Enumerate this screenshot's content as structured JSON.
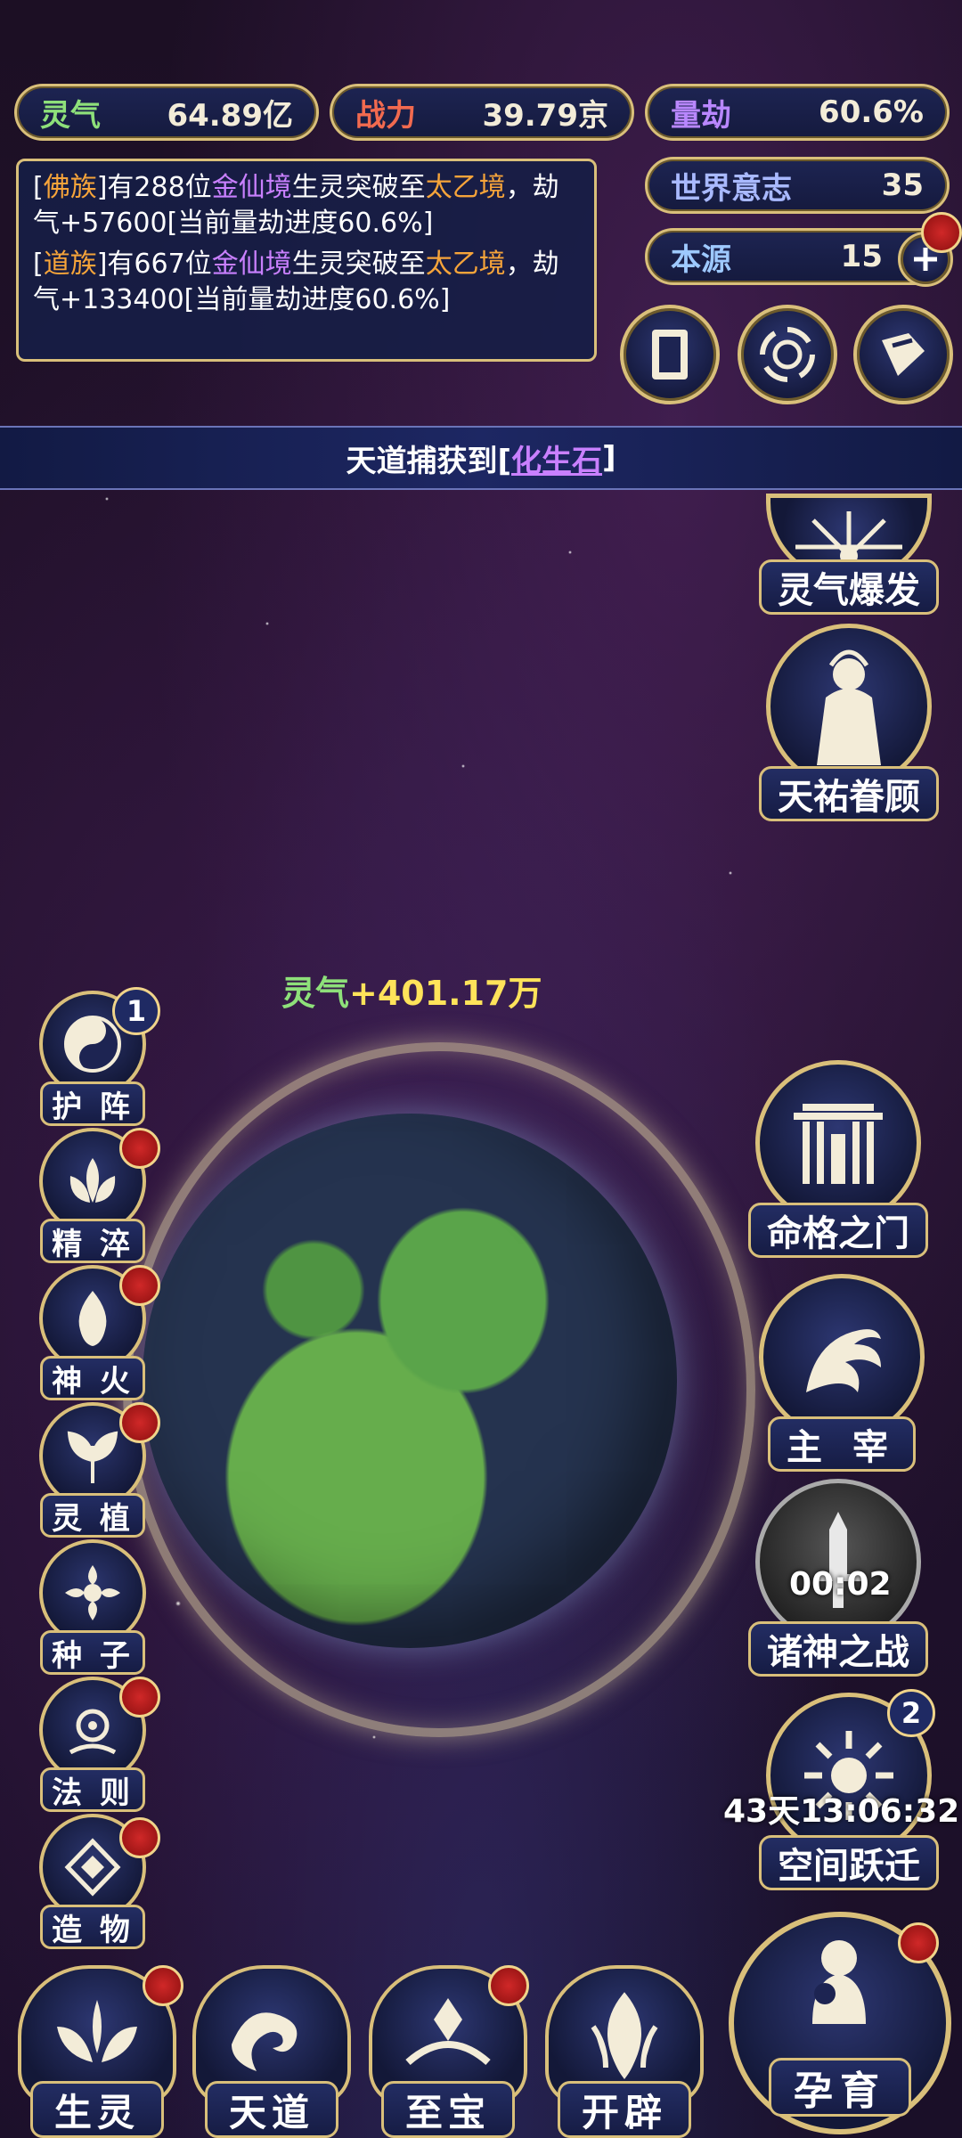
{
  "stats": {
    "lingqi": {
      "label": "灵气",
      "value": "64.89亿"
    },
    "zhanli": {
      "label": "战力",
      "value": "39.79京"
    },
    "liangjie": {
      "label": "量劫",
      "value": "60.6%"
    },
    "world_will": {
      "label": "世界意志",
      "value": "35"
    },
    "benyuan": {
      "label": "本源",
      "value": "15"
    }
  },
  "log": {
    "entries": [
      {
        "open": "[",
        "race": "佛族",
        "mid1": "]有288位",
        "realm": "金仙境",
        "mid2": "生灵突破至",
        "target": "太乙境",
        "rest": "，劫气+57600[当前量劫进度60.6%]"
      },
      {
        "open": "[",
        "race": "道族",
        "mid1": "]有667位",
        "realm": "金仙境",
        "mid2": "生灵突破至",
        "target": "太乙境",
        "rest": "，劫气+133400[当前量劫进度60.6%]"
      }
    ]
  },
  "banner": {
    "prefix": "天道捕获到[",
    "item": "化生石",
    "suffix": "]"
  },
  "gain": {
    "key": "灵气",
    "value": "+401.17万"
  },
  "left_menu": [
    {
      "label": "护 阵",
      "icon": "yin-yang-icon",
      "count": "1"
    },
    {
      "label": "精 淬",
      "icon": "lotus-icon"
    },
    {
      "label": "神 火",
      "icon": "flame-icon"
    },
    {
      "label": "灵 植",
      "icon": "plant-icon"
    },
    {
      "label": "种 子",
      "icon": "seed-icon"
    },
    {
      "label": "法 则",
      "icon": "rule-icon"
    },
    {
      "label": "造 物",
      "icon": "creation-icon"
    }
  ],
  "right_menu": {
    "burst": "灵气爆发",
    "blessing": "天祐眷顾",
    "fate_gate": "命格之门",
    "ruler": "主 宰",
    "gods_war": {
      "label": "诸神之战",
      "timer": "00:02"
    },
    "space_jump": {
      "label": "空间跃迁",
      "timer": "43天13:06:32",
      "count": "2"
    }
  },
  "bottom_nav": [
    "生灵",
    "天道",
    "至宝",
    "开辟"
  ],
  "breed": "孕育",
  "colors": {
    "gold": "#d9bf7a",
    "panel": "#1d2452",
    "alert": "#d02828"
  }
}
